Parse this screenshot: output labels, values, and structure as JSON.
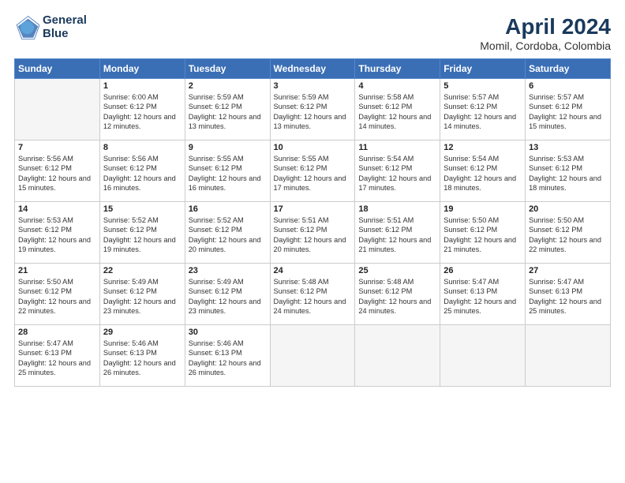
{
  "logo": {
    "line1": "General",
    "line2": "Blue"
  },
  "title": "April 2024",
  "location": "Momil, Cordoba, Colombia",
  "weekdays": [
    "Sunday",
    "Monday",
    "Tuesday",
    "Wednesday",
    "Thursday",
    "Friday",
    "Saturday"
  ],
  "weeks": [
    [
      {
        "day": "",
        "sunrise": "",
        "sunset": "",
        "daylight": ""
      },
      {
        "day": "1",
        "sunrise": "Sunrise: 6:00 AM",
        "sunset": "Sunset: 6:12 PM",
        "daylight": "Daylight: 12 hours and 12 minutes."
      },
      {
        "day": "2",
        "sunrise": "Sunrise: 5:59 AM",
        "sunset": "Sunset: 6:12 PM",
        "daylight": "Daylight: 12 hours and 13 minutes."
      },
      {
        "day": "3",
        "sunrise": "Sunrise: 5:59 AM",
        "sunset": "Sunset: 6:12 PM",
        "daylight": "Daylight: 12 hours and 13 minutes."
      },
      {
        "day": "4",
        "sunrise": "Sunrise: 5:58 AM",
        "sunset": "Sunset: 6:12 PM",
        "daylight": "Daylight: 12 hours and 14 minutes."
      },
      {
        "day": "5",
        "sunrise": "Sunrise: 5:57 AM",
        "sunset": "Sunset: 6:12 PM",
        "daylight": "Daylight: 12 hours and 14 minutes."
      },
      {
        "day": "6",
        "sunrise": "Sunrise: 5:57 AM",
        "sunset": "Sunset: 6:12 PM",
        "daylight": "Daylight: 12 hours and 15 minutes."
      }
    ],
    [
      {
        "day": "7",
        "sunrise": "Sunrise: 5:56 AM",
        "sunset": "Sunset: 6:12 PM",
        "daylight": "Daylight: 12 hours and 15 minutes."
      },
      {
        "day": "8",
        "sunrise": "Sunrise: 5:56 AM",
        "sunset": "Sunset: 6:12 PM",
        "daylight": "Daylight: 12 hours and 16 minutes."
      },
      {
        "day": "9",
        "sunrise": "Sunrise: 5:55 AM",
        "sunset": "Sunset: 6:12 PM",
        "daylight": "Daylight: 12 hours and 16 minutes."
      },
      {
        "day": "10",
        "sunrise": "Sunrise: 5:55 AM",
        "sunset": "Sunset: 6:12 PM",
        "daylight": "Daylight: 12 hours and 17 minutes."
      },
      {
        "day": "11",
        "sunrise": "Sunrise: 5:54 AM",
        "sunset": "Sunset: 6:12 PM",
        "daylight": "Daylight: 12 hours and 17 minutes."
      },
      {
        "day": "12",
        "sunrise": "Sunrise: 5:54 AM",
        "sunset": "Sunset: 6:12 PM",
        "daylight": "Daylight: 12 hours and 18 minutes."
      },
      {
        "day": "13",
        "sunrise": "Sunrise: 5:53 AM",
        "sunset": "Sunset: 6:12 PM",
        "daylight": "Daylight: 12 hours and 18 minutes."
      }
    ],
    [
      {
        "day": "14",
        "sunrise": "Sunrise: 5:53 AM",
        "sunset": "Sunset: 6:12 PM",
        "daylight": "Daylight: 12 hours and 19 minutes."
      },
      {
        "day": "15",
        "sunrise": "Sunrise: 5:52 AM",
        "sunset": "Sunset: 6:12 PM",
        "daylight": "Daylight: 12 hours and 19 minutes."
      },
      {
        "day": "16",
        "sunrise": "Sunrise: 5:52 AM",
        "sunset": "Sunset: 6:12 PM",
        "daylight": "Daylight: 12 hours and 20 minutes."
      },
      {
        "day": "17",
        "sunrise": "Sunrise: 5:51 AM",
        "sunset": "Sunset: 6:12 PM",
        "daylight": "Daylight: 12 hours and 20 minutes."
      },
      {
        "day": "18",
        "sunrise": "Sunrise: 5:51 AM",
        "sunset": "Sunset: 6:12 PM",
        "daylight": "Daylight: 12 hours and 21 minutes."
      },
      {
        "day": "19",
        "sunrise": "Sunrise: 5:50 AM",
        "sunset": "Sunset: 6:12 PM",
        "daylight": "Daylight: 12 hours and 21 minutes."
      },
      {
        "day": "20",
        "sunrise": "Sunrise: 5:50 AM",
        "sunset": "Sunset: 6:12 PM",
        "daylight": "Daylight: 12 hours and 22 minutes."
      }
    ],
    [
      {
        "day": "21",
        "sunrise": "Sunrise: 5:50 AM",
        "sunset": "Sunset: 6:12 PM",
        "daylight": "Daylight: 12 hours and 22 minutes."
      },
      {
        "day": "22",
        "sunrise": "Sunrise: 5:49 AM",
        "sunset": "Sunset: 6:12 PM",
        "daylight": "Daylight: 12 hours and 23 minutes."
      },
      {
        "day": "23",
        "sunrise": "Sunrise: 5:49 AM",
        "sunset": "Sunset: 6:12 PM",
        "daylight": "Daylight: 12 hours and 23 minutes."
      },
      {
        "day": "24",
        "sunrise": "Sunrise: 5:48 AM",
        "sunset": "Sunset: 6:12 PM",
        "daylight": "Daylight: 12 hours and 24 minutes."
      },
      {
        "day": "25",
        "sunrise": "Sunrise: 5:48 AM",
        "sunset": "Sunset: 6:12 PM",
        "daylight": "Daylight: 12 hours and 24 minutes."
      },
      {
        "day": "26",
        "sunrise": "Sunrise: 5:47 AM",
        "sunset": "Sunset: 6:13 PM",
        "daylight": "Daylight: 12 hours and 25 minutes."
      },
      {
        "day": "27",
        "sunrise": "Sunrise: 5:47 AM",
        "sunset": "Sunset: 6:13 PM",
        "daylight": "Daylight: 12 hours and 25 minutes."
      }
    ],
    [
      {
        "day": "28",
        "sunrise": "Sunrise: 5:47 AM",
        "sunset": "Sunset: 6:13 PM",
        "daylight": "Daylight: 12 hours and 25 minutes."
      },
      {
        "day": "29",
        "sunrise": "Sunrise: 5:46 AM",
        "sunset": "Sunset: 6:13 PM",
        "daylight": "Daylight: 12 hours and 26 minutes."
      },
      {
        "day": "30",
        "sunrise": "Sunrise: 5:46 AM",
        "sunset": "Sunset: 6:13 PM",
        "daylight": "Daylight: 12 hours and 26 minutes."
      },
      {
        "day": "",
        "sunrise": "",
        "sunset": "",
        "daylight": ""
      },
      {
        "day": "",
        "sunrise": "",
        "sunset": "",
        "daylight": ""
      },
      {
        "day": "",
        "sunrise": "",
        "sunset": "",
        "daylight": ""
      },
      {
        "day": "",
        "sunrise": "",
        "sunset": "",
        "daylight": ""
      }
    ]
  ]
}
